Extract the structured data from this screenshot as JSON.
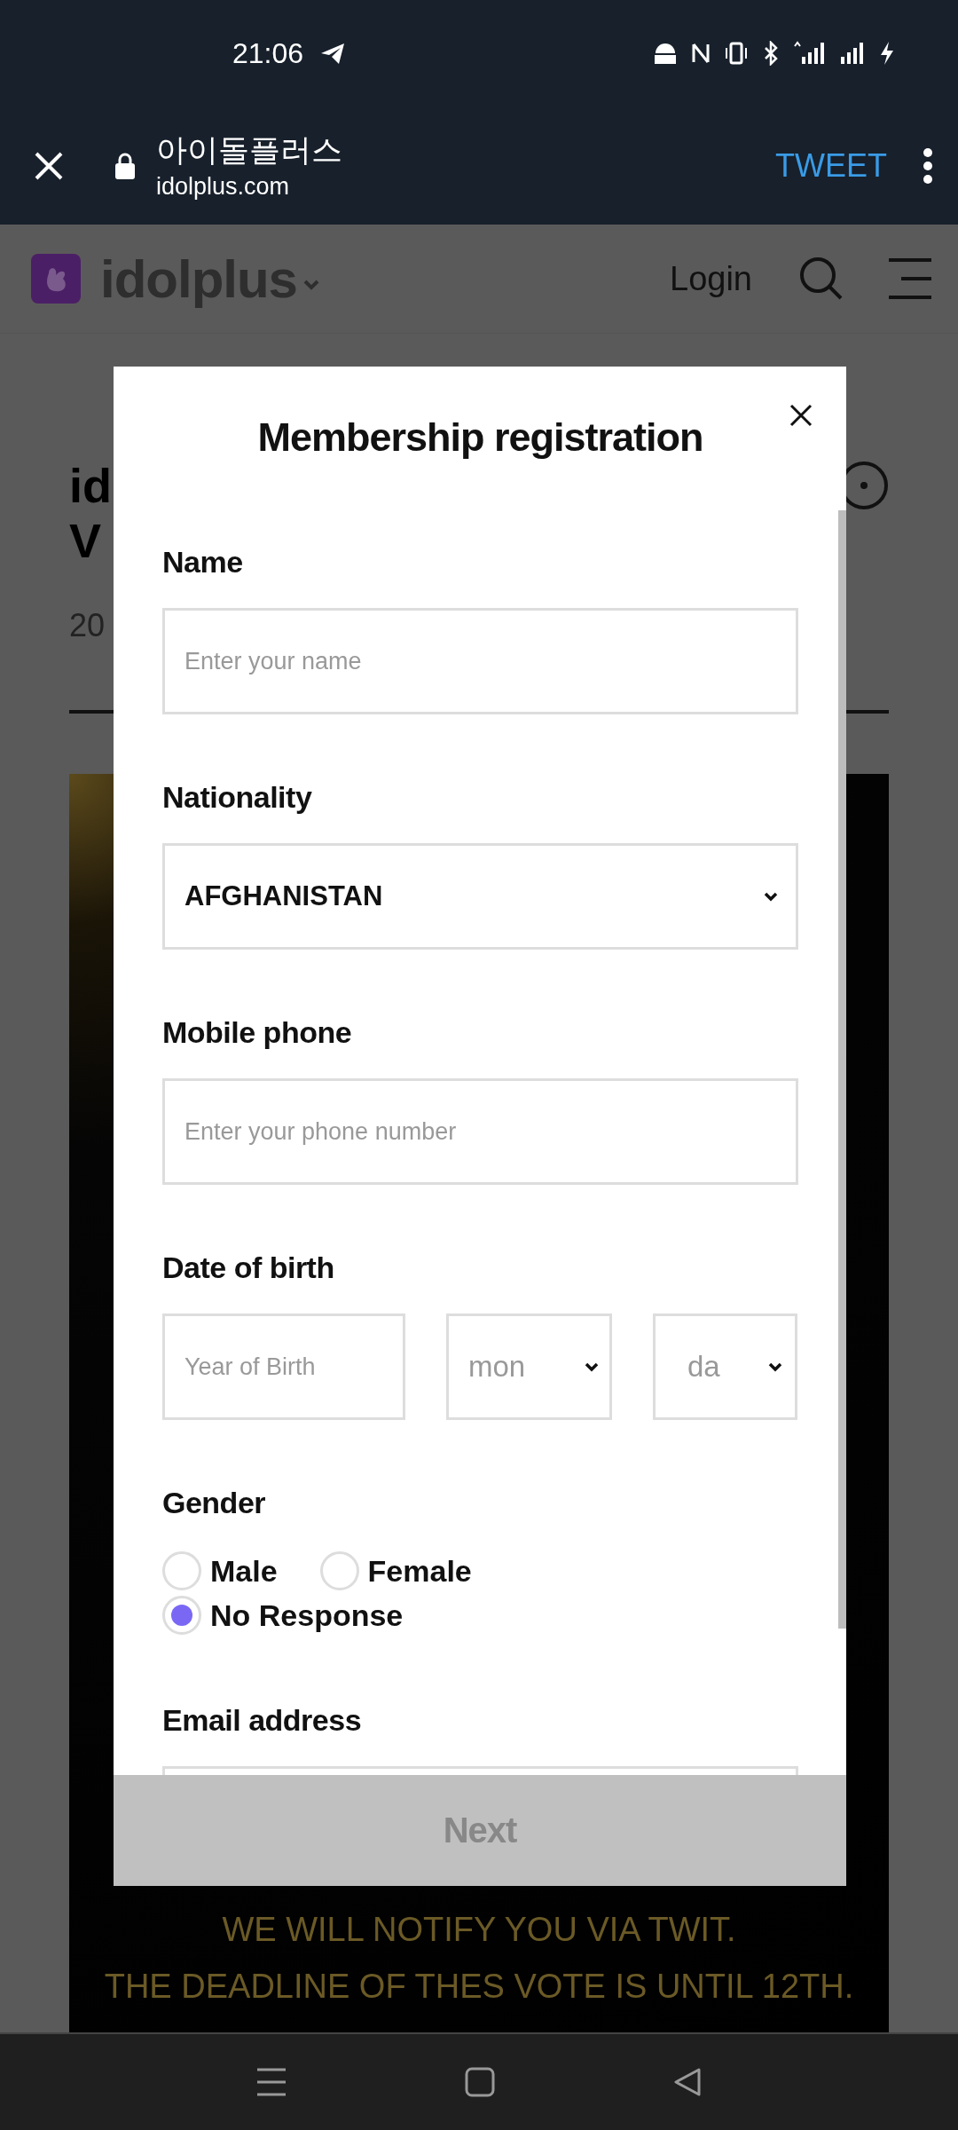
{
  "status_bar": {
    "time": "21:06"
  },
  "browser_bar": {
    "title": "아이돌플러스",
    "url": "idolplus.com",
    "action": "TWEET"
  },
  "site_header": {
    "logo_text": "idolplus",
    "login": "Login"
  },
  "background": {
    "heading_lines": [
      "id",
      "V"
    ],
    "date": "20",
    "notices": [
      "WE WILL NOTIFY YOU VIA TWIT.",
      "THE DEADLINE OF THES VOTE IS UNTIL 12TH."
    ]
  },
  "modal": {
    "title": "Membership registration",
    "fields": [
      {
        "kind": "text",
        "label": "Name",
        "placeholder": "Enter your name"
      },
      {
        "kind": "select",
        "label": "Nationality",
        "value": "AFGHANISTAN"
      },
      {
        "kind": "text",
        "label": "Mobile phone",
        "placeholder": "Enter your phone number"
      },
      {
        "kind": "date",
        "label": "Date of birth",
        "year_placeholder": "Year of Birth",
        "month": "mon",
        "day": "da"
      },
      {
        "kind": "radio",
        "label": "Gender",
        "options": [
          {
            "label": "Male",
            "selected": false
          },
          {
            "label": "Female",
            "selected": false
          },
          {
            "label": "No Response",
            "selected": true
          }
        ]
      },
      {
        "kind": "text",
        "label": "Email address"
      }
    ],
    "next_button": {
      "label": "Next",
      "disabled": true
    }
  }
}
